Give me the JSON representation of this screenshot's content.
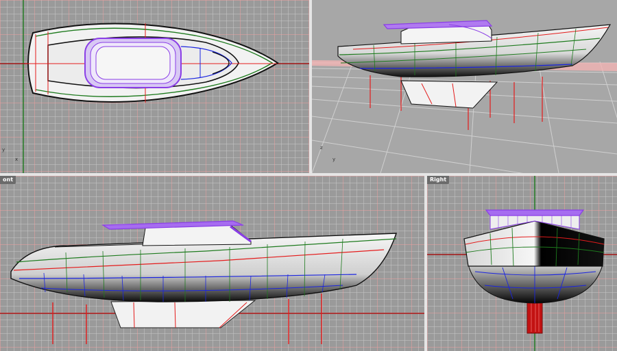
{
  "viewports": {
    "top": {
      "label": "",
      "axis_y": "y",
      "axis_x": "x"
    },
    "perspective": {
      "label": "",
      "axis_y": "z",
      "axis_x": "y"
    },
    "front": {
      "label": "ont"
    },
    "right": {
      "label": "Right"
    }
  },
  "colors": {
    "viewport_bg": "#9a9a9a",
    "grid_minor": "#c9c9c9",
    "grid_major": "#f0a0a0",
    "hull_dark": "#111111",
    "hull_light": "#f5f5f5",
    "curve_red": "#e41b1b",
    "curve_green": "#1d7a1d",
    "curve_blue": "#1a24e0",
    "cabin_purple": "#8a3ee6"
  }
}
